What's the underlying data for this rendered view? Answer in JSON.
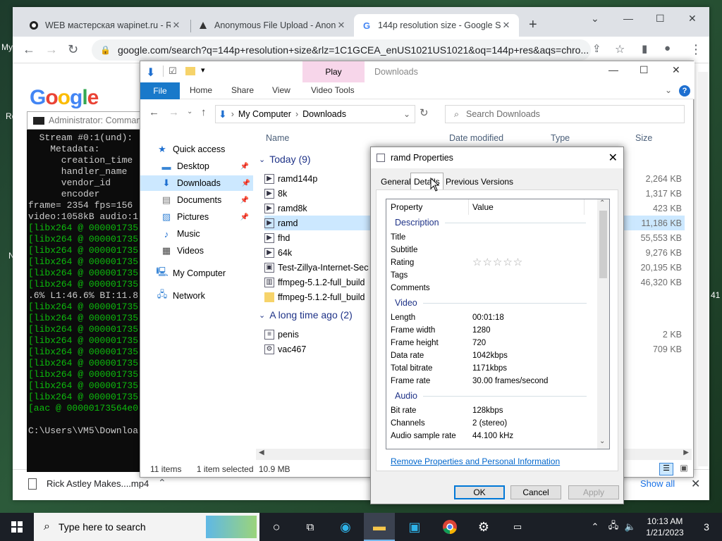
{
  "desktop": {
    "left_label_1": "My",
    "left_label_2": "Re",
    "left_label_3": "N",
    "right_label": "41"
  },
  "chrome": {
    "tabs": [
      {
        "title": "WEB мастерская wapinet.ru - Ri",
        "icon": "wapinet-icon"
      },
      {
        "title": "Anonymous File Upload - AnonF",
        "icon": "anonfiles-icon"
      },
      {
        "title": "144p resolution size - Google Se",
        "icon": "google-icon"
      }
    ],
    "url": "google.com/search?q=144p+resolution+size&rlz=1C1GCEA_enUS1021US1021&oq=144p+res&aqs=chro...",
    "logo": "Google",
    "download_item": "Rick Astley Makes....mp4",
    "show_all": "Show all"
  },
  "cmd": {
    "title": "Administrator: Command",
    "lines": [
      "  Stream #0:1(und):",
      "    Metadata:",
      "      creation_time",
      "      handler_name",
      "      vendor_id",
      "      encoder",
      "frame= 2354 fps=156",
      "video:1058kB audio:1",
      "[libx264 @ 000001735",
      "[libx264 @ 000001735",
      "[libx264 @ 000001735",
      "[libx264 @ 000001735",
      "[libx264 @ 000001735",
      "[libx264 @ 000001735",
      ".6% L1:46.6% BI:11.8",
      "[libx264 @ 000001735",
      "[libx264 @ 000001735",
      "[libx264 @ 000001735",
      "[libx264 @ 000001735",
      "[libx264 @ 000001735",
      "[libx264 @ 000001735",
      "[libx264 @ 000001735",
      "[libx264 @ 000001735",
      "[libx264 @ 000001735",
      "[aac @ 00000173564e0",
      "",
      "C:\\Users\\VM5\\Downloa"
    ]
  },
  "explorer": {
    "title": "Downloads",
    "play_tab": "Play",
    "ribbon_tabs": [
      "File",
      "Home",
      "Share",
      "View",
      "Video Tools"
    ],
    "path": [
      "My Computer",
      "Downloads"
    ],
    "search_placeholder": "Search Downloads",
    "sidebar": [
      "Quick access",
      "Desktop",
      "Downloads",
      "Documents",
      "Pictures",
      "Music",
      "Videos",
      "My Computer",
      "Network"
    ],
    "columns": [
      "Name",
      "Date modified",
      "Type",
      "Size"
    ],
    "group_today": "Today (9)",
    "group_old": "A long time ago (2)",
    "files_today": [
      {
        "name": "ramd144p",
        "size": "2,264 KB"
      },
      {
        "name": "8k",
        "size": "1,317 KB"
      },
      {
        "name": "ramd8k",
        "size": "423 KB"
      },
      {
        "name": "ramd",
        "size": "11,186 KB"
      },
      {
        "name": "fhd",
        "size": "55,553 KB"
      },
      {
        "name": "64k",
        "size": "9,276 KB"
      },
      {
        "name": "Test-Zillya-Internet-Secu",
        "size": "20,195 KB"
      },
      {
        "name": "ffmpeg-5.1.2-full_build",
        "size": "46,320 KB"
      },
      {
        "name": "ffmpeg-5.1.2-full_build",
        "size": ""
      }
    ],
    "files_old": [
      {
        "name": "penis",
        "size": "2 KB"
      },
      {
        "name": "vac467",
        "size": "709 KB"
      }
    ],
    "status": {
      "items": "11 items",
      "selected": "1 item selected",
      "size": "10.9 MB"
    }
  },
  "props": {
    "title": "ramd Properties",
    "tabs": [
      "General",
      "Details",
      "Previous Versions"
    ],
    "head_property": "Property",
    "head_value": "Value",
    "sections": {
      "description": "Description",
      "video": "Video",
      "audio": "Audio"
    },
    "desc_rows": [
      "Title",
      "Subtitle",
      "Rating",
      "Tags",
      "Comments"
    ],
    "rating_stars": "☆☆☆☆☆",
    "video_rows": [
      {
        "k": "Length",
        "v": "00:01:18"
      },
      {
        "k": "Frame width",
        "v": "1280"
      },
      {
        "k": "Frame height",
        "v": "720"
      },
      {
        "k": "Data rate",
        "v": "1042kbps"
      },
      {
        "k": "Total bitrate",
        "v": "1171kbps"
      },
      {
        "k": "Frame rate",
        "v": "30.00 frames/second"
      }
    ],
    "audio_rows": [
      {
        "k": "Bit rate",
        "v": "128kbps"
      },
      {
        "k": "Channels",
        "v": "2 (stereo)"
      },
      {
        "k": "Audio sample rate",
        "v": "44.100 kHz"
      }
    ],
    "remove_link": "Remove Properties and Personal Information",
    "ok": "OK",
    "cancel": "Cancel",
    "apply": "Apply"
  },
  "taskbar": {
    "search_placeholder": "Type here to search",
    "time": "10:13 AM",
    "date": "1/21/2023",
    "notifications": "3"
  }
}
